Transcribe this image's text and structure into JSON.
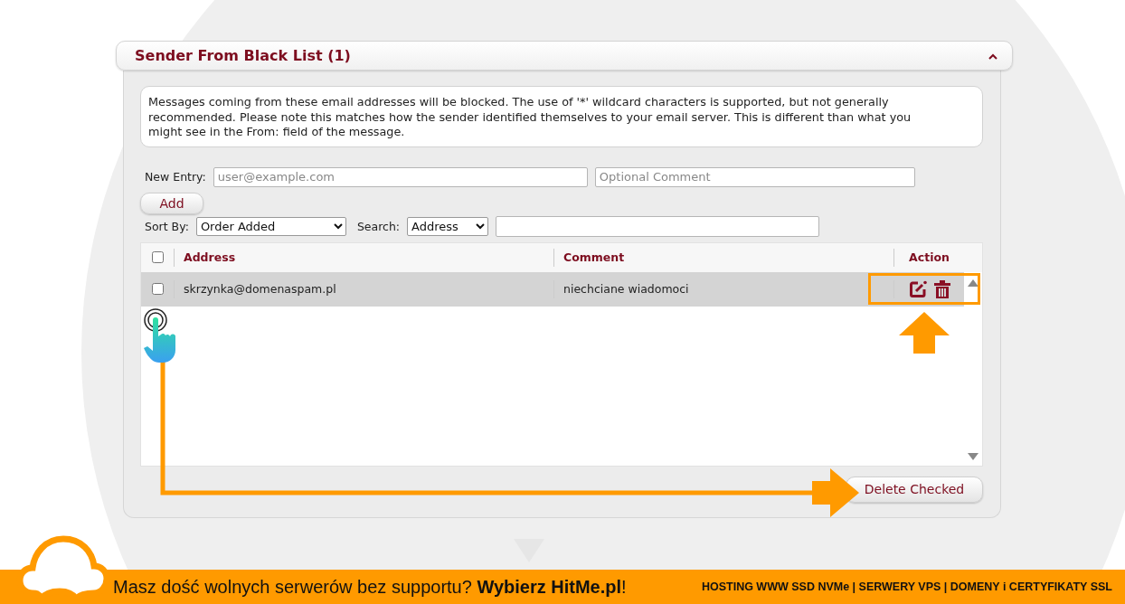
{
  "panel": {
    "title": "Sender From Black List (1)",
    "expanded": true
  },
  "description": "Messages coming from these email addresses will be blocked. The use of '*' wildcard characters is supported, but not generally recommended. Please note this matches how the sender identified themselves to your email server. This is different than what you might see in the From: field of the message.",
  "new_entry": {
    "label": "New Entry:",
    "address_placeholder": "user@example.com",
    "comment_placeholder": "Optional Comment"
  },
  "add_button": "Add",
  "sort": {
    "label": "Sort By:",
    "value": "Order Added"
  },
  "search": {
    "label": "Search:",
    "field": "Address"
  },
  "table": {
    "columns": [
      "Address",
      "Comment",
      "Action"
    ],
    "select_all_checked": false,
    "rows": [
      {
        "address": "skrzynka@domenaspam.pl",
        "comment": "niechciane wiadomoci",
        "checked": false,
        "selected": true
      }
    ]
  },
  "delete_button": "Delete Checked",
  "banner": {
    "slogan": "Masz dość wolnych serwerów bez supportu? **Wybierz HitMe.pl**!",
    "services": "HOSTING WWW SSD NVMe | SERWERY VPS | DOMENY i CERTYFIKATY SSL"
  }
}
